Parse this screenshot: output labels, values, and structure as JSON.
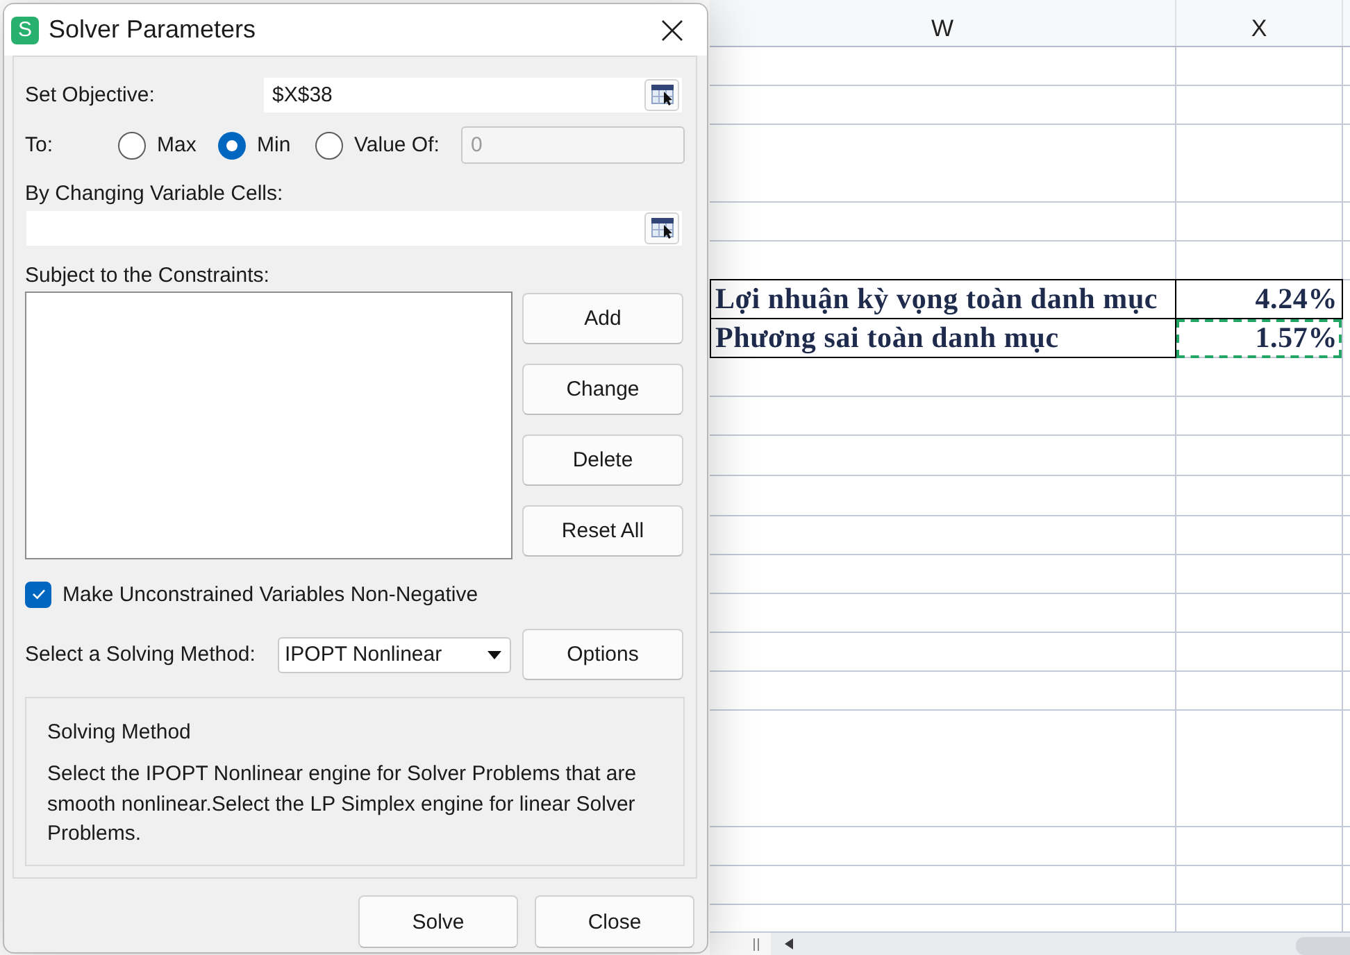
{
  "window": {
    "title": "Solver Parameters",
    "icon_letter": "S"
  },
  "objective": {
    "label": "Set Objective:",
    "value": "$X$38"
  },
  "to": {
    "label": "To:",
    "options": [
      {
        "label": "Max",
        "selected": false
      },
      {
        "label": "Min",
        "selected": true
      },
      {
        "label": "Value Of:",
        "selected": false
      }
    ],
    "value_field": {
      "value": "0",
      "disabled": true
    }
  },
  "changing_cells": {
    "label": "By Changing Variable Cells:"
  },
  "constraints": {
    "label": "Subject to the Constraints:",
    "buttons": [
      "Add",
      "Change",
      "Delete",
      "Reset All"
    ]
  },
  "non_negative": {
    "label": "Make Unconstrained Variables Non-Negative",
    "checked": true
  },
  "solving_method": {
    "label": "Select a Solving Method:",
    "value": "IPOPT Nonlinear",
    "button": "Options"
  },
  "description": {
    "title": "Solving Method",
    "text": "Select the IPOPT Nonlinear engine for Solver Problems that are smooth nonlinear.Select the LP Simplex engine for linear Solver Problems."
  },
  "footer_buttons": [
    "Solve",
    "Close"
  ],
  "sheet": {
    "columns": [
      "W",
      "X"
    ],
    "rows": [
      {
        "label": "Lợi nhuận kỳ vọng toàn danh mục",
        "value": "4.24%",
        "copy_marquee": false
      },
      {
        "label": "Phương sai toàn danh mục",
        "value": "1.57%",
        "copy_marquee": true
      }
    ]
  }
}
